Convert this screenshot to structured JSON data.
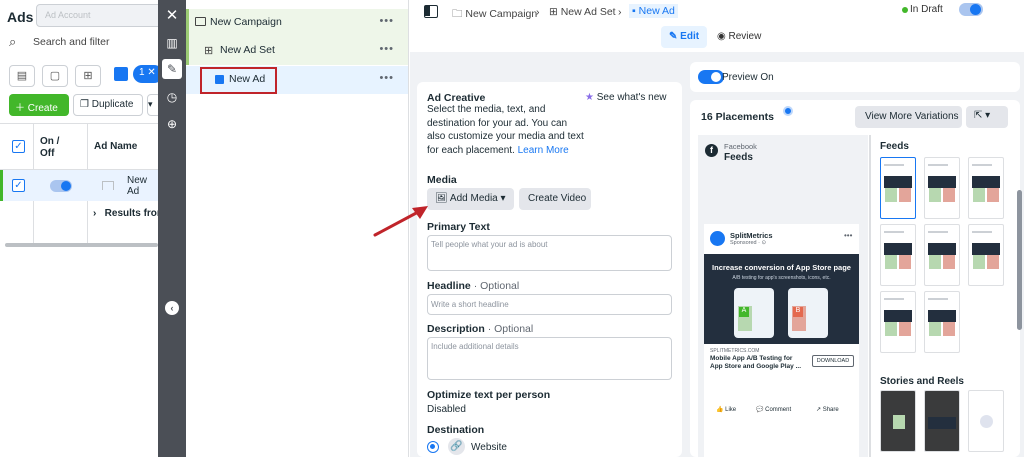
{
  "left_panel": {
    "title": "Ads",
    "search_placeholder": "Search and filter",
    "selected_count": "1 ✕",
    "create_label": "Create",
    "duplicate_label": "Duplicate",
    "columns": {
      "on_off": "On / Off",
      "ad_name": "Ad Name"
    },
    "row_ad_name": "New Ad",
    "results_label": "Results from"
  },
  "tree": {
    "campaign": "New Campaign",
    "ad_set": "New Ad Set",
    "ad": "New Ad",
    "dots": "•••"
  },
  "breadcrumb": {
    "campaign": "New Campaign",
    "ad_set": "New Ad Set",
    "ad": "New Ad",
    "separator": "›"
  },
  "status": {
    "label": "In Draft",
    "dot_color": "#42b72a"
  },
  "mode_tabs": {
    "edit": "Edit",
    "review": "Review"
  },
  "ad_creative": {
    "title": "Ad Creative",
    "see_new": "See what's new",
    "description": "Select the media, text, and destination for your ad. You can also customize your media and text for each placement.",
    "learn_more": "Learn More",
    "media_label": "Media",
    "add_media": "Add Media",
    "create_video": "Create Video",
    "primary_text_label": "Primary Text",
    "primary_text_placeholder": "Tell people what your ad is about",
    "headline_label": "Headline",
    "optional": "· Optional",
    "headline_placeholder": "Write a short headline",
    "description_label": "Description",
    "description_placeholder": "Include additional details",
    "optimize_label": "Optimize text per person",
    "optimize_value": "Disabled",
    "destination_label": "Destination",
    "destination_value": "Website"
  },
  "preview": {
    "toggle_label": "Preview On",
    "placements": "16 Placements",
    "view_more": "View More Variations",
    "ext_label": "⇱ ▾",
    "fb_sub": "Facebook",
    "fb_title": "Feeds",
    "feeds_label": "Feeds",
    "stories_label": "Stories and Reels",
    "post": {
      "brand": "SplitMetrics",
      "sponsored": "Sponsored · ⊙",
      "headline": "Increase conversion of App Store page",
      "sub": "A/B testing for app's screenshots, icons, etc.",
      "url": "SPLITMETRICS.COM",
      "cta_title": "Mobile App A/B Testing for App Store and Google Play ...",
      "download": "DOWNLOAD",
      "like": "Like",
      "comment": "Comment",
      "share": "Share"
    }
  },
  "colors": {
    "accent": "#1877f2",
    "annotation": "#c0242a",
    "tree_highlight": "#eef6e9"
  }
}
